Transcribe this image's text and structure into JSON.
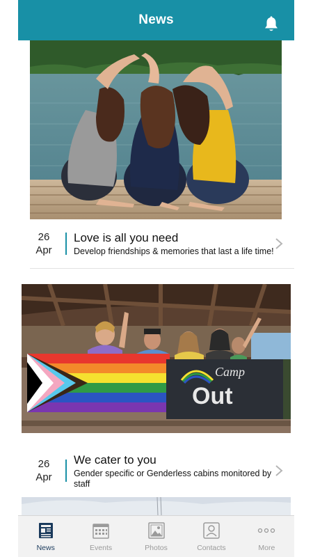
{
  "header": {
    "title": "News",
    "icon": "bell-icon"
  },
  "news": [
    {
      "day": "26",
      "month": "Apr",
      "title": "Love is all you need",
      "description": "Develop friendships & memories that last a life time!"
    },
    {
      "day": "26",
      "month": "Apr",
      "title": "We cater to you",
      "description": "Gender specific or Genderless cabins monitored by staff"
    }
  ],
  "banner": {
    "line1": "Camp",
    "line2": "Out"
  },
  "tabs": [
    {
      "label": "News",
      "icon": "newspaper-icon",
      "active": true
    },
    {
      "label": "Events",
      "icon": "calendar-icon",
      "active": false
    },
    {
      "label": "Photos",
      "icon": "photo-icon",
      "active": false
    },
    {
      "label": "Contacts",
      "icon": "contact-card-icon",
      "active": false
    },
    {
      "label": "More",
      "icon": "more-dots-icon",
      "active": false
    }
  ],
  "colors": {
    "accent": "#1890a6",
    "tab_active": "#1a3a5c",
    "tab_inactive": "#9a9a9a"
  }
}
